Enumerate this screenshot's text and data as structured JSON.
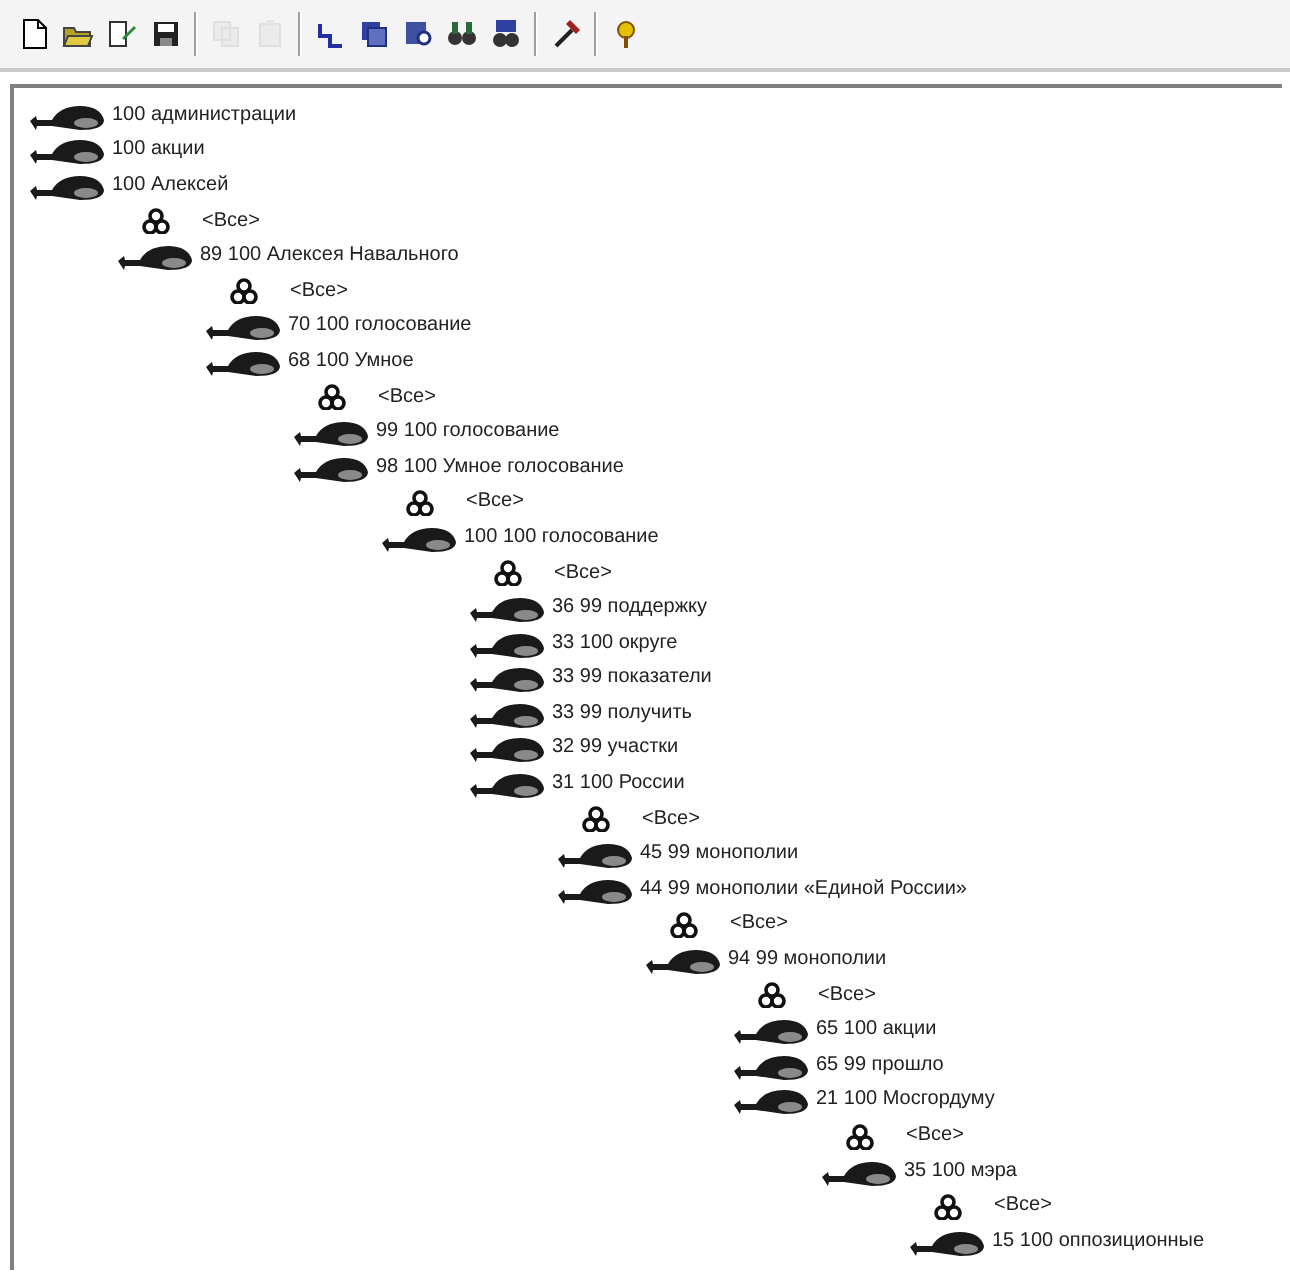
{
  "toolbar": [
    [
      {
        "disabled": false
      },
      {
        "disabled": false
      },
      {
        "disabled": false
      },
      {
        "disabled": false
      }
    ],
    [
      {
        "disabled": true
      },
      {
        "disabled": true
      }
    ],
    [
      {
        "disabled": false
      },
      {
        "disabled": false
      },
      {
        "disabled": false
      },
      {
        "disabled": false
      },
      {
        "disabled": false
      }
    ],
    [
      {
        "disabled": false
      }
    ],
    [
      {
        "disabled": false
      }
    ]
  ],
  "tree": [
    {
      "kind": "term",
      "label": "100 администрации"
    },
    {
      "kind": "term",
      "label": "100 акции"
    },
    {
      "kind": "term",
      "label": "100 Алексей",
      "children": [
        {
          "kind": "all",
          "label": "<Все>"
        },
        {
          "kind": "term",
          "label": "89 100 Алексея Навального",
          "children": [
            {
              "kind": "all",
              "label": "<Все>"
            },
            {
              "kind": "term",
              "label": "70 100 голосование"
            },
            {
              "kind": "term",
              "label": "68 100 Умное",
              "children": [
                {
                  "kind": "all",
                  "label": "<Все>"
                },
                {
                  "kind": "term",
                  "label": "99 100 голосование"
                },
                {
                  "kind": "term",
                  "label": "98 100 Умное голосование",
                  "children": [
                    {
                      "kind": "all",
                      "label": "<Все>"
                    },
                    {
                      "kind": "term",
                      "label": "100 100 голосование",
                      "children": [
                        {
                          "kind": "all",
                          "label": "<Все>"
                        },
                        {
                          "kind": "term",
                          "label": "36 99 поддержку"
                        },
                        {
                          "kind": "term",
                          "label": "33 100 округе"
                        },
                        {
                          "kind": "term",
                          "label": "33 99 показатели"
                        },
                        {
                          "kind": "term",
                          "label": "33 99 получить"
                        },
                        {
                          "kind": "term",
                          "label": "32 99 участки"
                        },
                        {
                          "kind": "term",
                          "label": "31 100 России",
                          "children": [
                            {
                              "kind": "all",
                              "label": "<Все>"
                            },
                            {
                              "kind": "term",
                              "label": "45 99 монополии"
                            },
                            {
                              "kind": "term",
                              "label": "44 99 монополии «Единой России»",
                              "children": [
                                {
                                  "kind": "all",
                                  "label": "<Все>"
                                },
                                {
                                  "kind": "term",
                                  "label": "94 99 монополии",
                                  "children": [
                                    {
                                      "kind": "all",
                                      "label": "<Все>"
                                    },
                                    {
                                      "kind": "term",
                                      "label": "65 100 акции"
                                    },
                                    {
                                      "kind": "term",
                                      "label": "65 99 прошло"
                                    },
                                    {
                                      "kind": "term",
                                      "label": "21 100 Мосгордуму",
                                      "children": [
                                        {
                                          "kind": "all",
                                          "label": "<Все>"
                                        },
                                        {
                                          "kind": "term",
                                          "label": "35 100 мэра",
                                          "children": [
                                            {
                                              "kind": "all",
                                              "label": "<Все>"
                                            },
                                            {
                                              "kind": "term",
                                              "label": "15 100 оппозиционные"
                                            }
                                          ]
                                        }
                                      ]
                                    }
                                  ]
                                }
                              ]
                            }
                          ]
                        }
                      ]
                    }
                  ]
                }
              ]
            }
          ]
        }
      ]
    }
  ]
}
